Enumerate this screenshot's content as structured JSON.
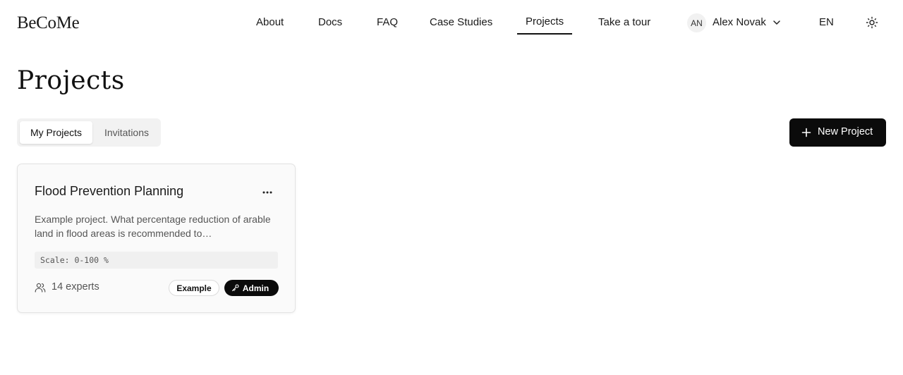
{
  "app": {
    "logo": "BeCoMe"
  },
  "nav": {
    "items": [
      {
        "label": "About"
      },
      {
        "label": "Docs"
      },
      {
        "label": "FAQ"
      },
      {
        "label": "Case Studies"
      },
      {
        "label": "Projects",
        "active": true
      },
      {
        "label": "Take a tour"
      }
    ],
    "user": {
      "initials": "AN",
      "name": "Alex Novak"
    },
    "language": "EN",
    "theme_icon": "sun-icon"
  },
  "page": {
    "title": "Projects",
    "tabs": [
      {
        "label": "My Projects",
        "active": true
      },
      {
        "label": "Invitations",
        "active": false
      }
    ],
    "new_button_label": "New Project"
  },
  "projects": [
    {
      "title": "Flood Prevention Planning",
      "description": "Example project. What percentage reduction of arable land in flood areas is recommended to…",
      "scale": "Scale: 0-100 %",
      "experts": "14 experts",
      "badges": [
        "Example",
        "Admin"
      ]
    }
  ],
  "colors": {
    "primary": "#0b0b0b",
    "muted_text": "#555555",
    "card_bg": "#fafafa"
  }
}
